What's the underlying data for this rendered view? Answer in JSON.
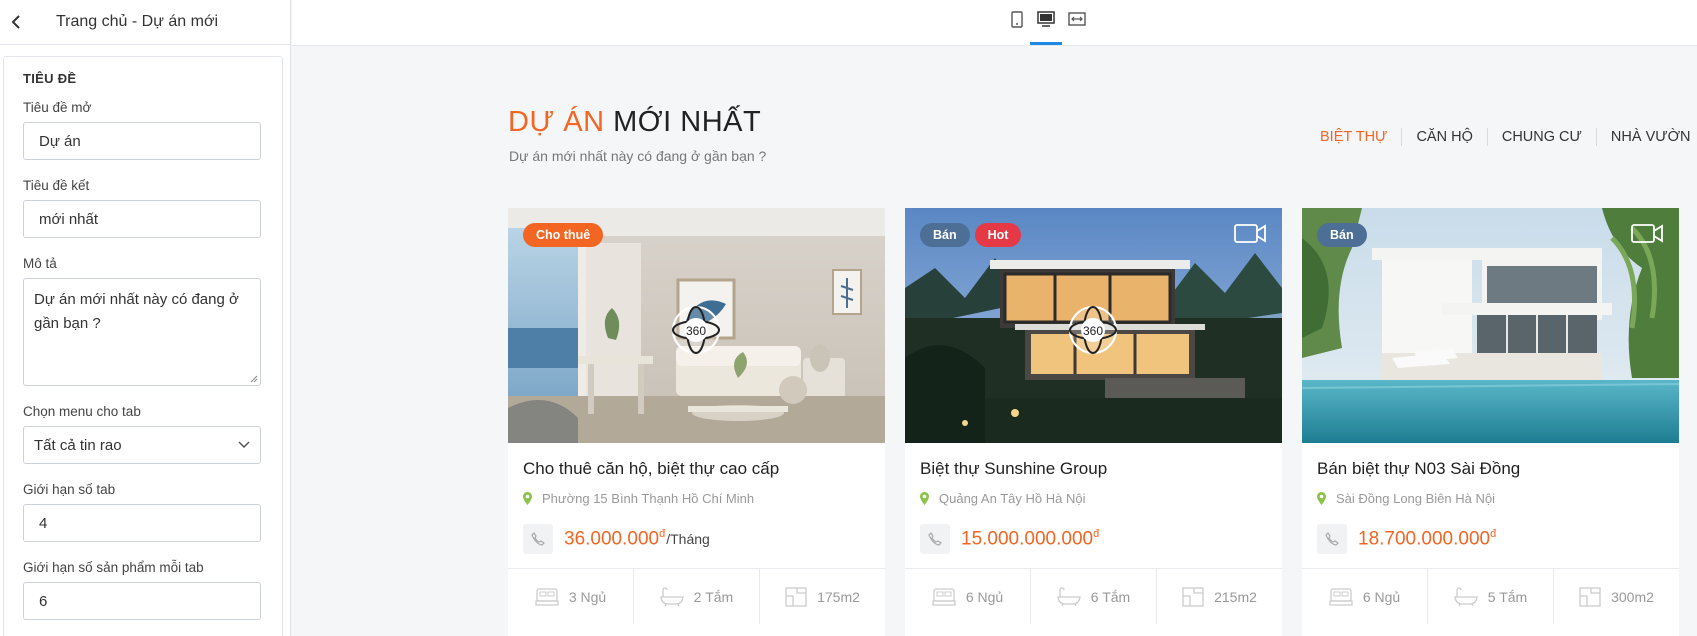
{
  "editor": {
    "header_title": "Trang chủ - Dự án mới",
    "panel_heading": "TIÊU ĐỀ",
    "fields": {
      "title_open_label": "Tiêu đề mở",
      "title_open_value": "Dự án",
      "title_close_label": "Tiêu đề kết",
      "title_close_value": "mới nhất",
      "desc_label": "Mô tả",
      "desc_value": "Dự án mới nhất này có đang ở gần bạn ?",
      "menu_label": "Chọn menu cho tab",
      "menu_value": "Tất cả tin rao",
      "tab_limit_label": "Giới hạn số tab",
      "tab_limit_value": "4",
      "product_limit_label": "Giới hạn số sản phẩm mỗi tab",
      "product_limit_value": "6"
    }
  },
  "toolbar": {
    "devices": [
      "mobile-icon",
      "desktop-icon",
      "fullwidth-icon"
    ],
    "active_device": "desktop",
    "accent": "#1e88e5"
  },
  "preview": {
    "title_accent": "DỰ ÁN",
    "title_rest": "MỚI NHẤT",
    "subtitle": "Dự án mới nhất này có đang ở gần bạn ?",
    "tabs": [
      {
        "label": "BIỆT THỰ",
        "active": true
      },
      {
        "label": "CĂN HỘ",
        "active": false
      },
      {
        "label": "CHUNG CƯ",
        "active": false
      },
      {
        "label": "NHÀ VƯỜN",
        "active": false
      }
    ],
    "accent_color": "#f26522",
    "cards": [
      {
        "badges": [
          "Cho thuê"
        ],
        "has_360": true,
        "has_video": false,
        "title": "Cho thuê căn hộ, biệt thự cao cấp",
        "location": "Phường 15 Bình Thạnh Hồ Chí Minh",
        "price": "36.000.000",
        "currency": "đ",
        "unit": "/Tháng",
        "beds": "3 Ngủ",
        "baths": "2 Tắm",
        "area": "175m2"
      },
      {
        "badges": [
          "Bán",
          "Hot"
        ],
        "has_360": true,
        "has_video": true,
        "title": "Biệt thự Sunshine Group",
        "location": "Quảng An Tây Hồ Hà Nội",
        "price": "15.000.000.000",
        "currency": "đ",
        "unit": "",
        "beds": "6 Ngủ",
        "baths": "6 Tắm",
        "area": "215m2"
      },
      {
        "badges": [
          "Bán"
        ],
        "has_360": false,
        "has_video": true,
        "title": "Bán biệt thự N03 Sài Đồng",
        "location": "Sài Đồng Long Biên Hà Nội",
        "price": "18.700.000.000",
        "currency": "đ",
        "unit": "",
        "beds": "6 Ngủ",
        "baths": "5 Tắm",
        "area": "300m2"
      }
    ],
    "badge_colors": {
      "Cho thuê": "#f26522",
      "Bán": "#4d6f96",
      "Hot": "#e53945"
    }
  }
}
